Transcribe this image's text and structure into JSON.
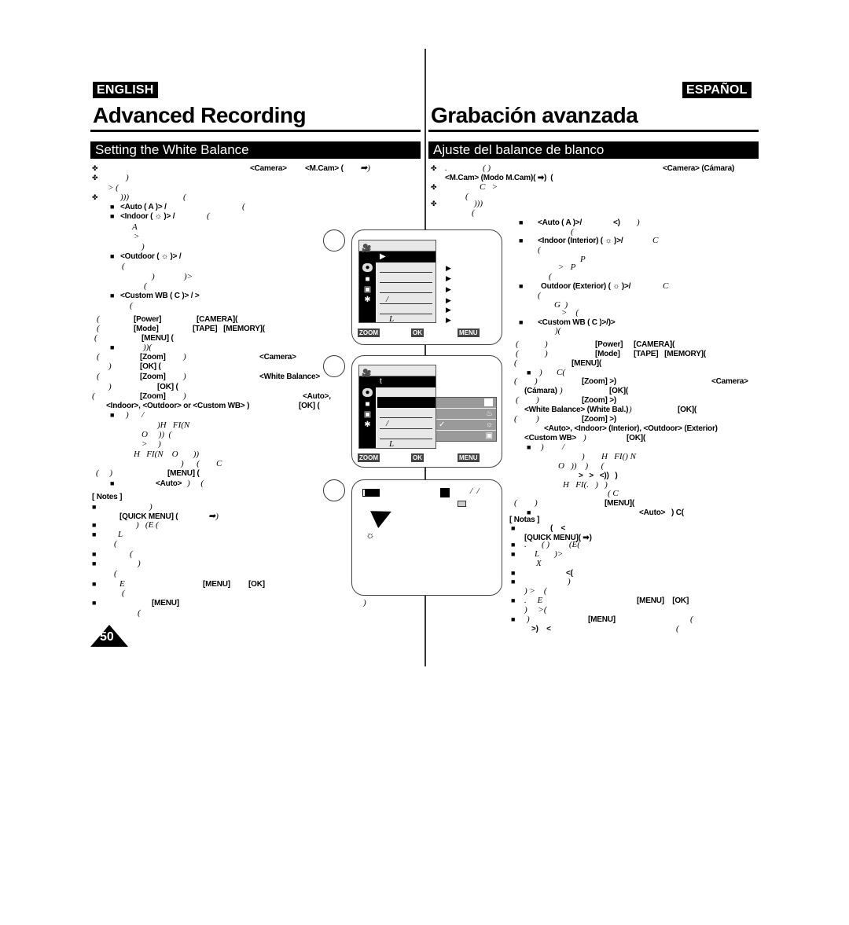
{
  "header": {
    "lang_en": "ENGLISH",
    "lang_es": "ESPAÑOL",
    "title_en": "Advanced Recording",
    "title_es": "Grabación avanzada",
    "section_en": "Setting the White Balance",
    "section_es": "Ajuste del balance de blanco"
  },
  "english": {
    "lines": [
      [
        "✤",
        "<Camera>",
        "<M.Cam> (",
        "➡)"
      ],
      [
        "✤",
        ")"
      ],
      [
        "> ("
      ],
      [
        "✤",
        ")))",
        "("
      ],
      [
        "■",
        "<Auto ( A )> /",
        "("
      ],
      [
        "■",
        "<Indoor ( ☼ )> /",
        "("
      ],
      [
        "A"
      ],
      [
        ">"
      ],
      [
        ")"
      ],
      [
        "■",
        "<Outdoor ( ☼ )> /"
      ],
      [
        "("
      ],
      [
        ")",
        ")>"
      ],
      [
        "("
      ],
      [
        "■",
        "<Custom WB ( C )> / >"
      ],
      [
        "("
      ],
      [
        "(",
        "[Power]",
        "[CAMERA]("
      ],
      [
        "(",
        "[Mode]",
        "[TAPE]   [MEMORY]("
      ],
      [
        "(",
        "[MENU] ("
      ],
      [
        "■",
        "))("
      ],
      [
        "(",
        "[Zoom]",
        ")",
        "<Camera>"
      ],
      [
        ")",
        "[OK] ("
      ],
      [
        "(",
        "[Zoom]",
        ")",
        "<White Balance>"
      ],
      [
        ")",
        "[OK] ("
      ],
      [
        "(",
        "[Zoom]",
        ")",
        "<Auto>,"
      ],
      [
        "<Indoor>, <Outdoor> or <Custom WB> )",
        "[OK] ("
      ],
      [
        "■",
        ")      /"
      ],
      [
        ")H   FI(N"
      ],
      [
        "O     ))  ("
      ],
      [
        ">     )"
      ],
      [
        "H   FI(N    O       ))"
      ],
      [
        ")      (",
        "C"
      ],
      [
        "(     )",
        "[MENU] ("
      ],
      [
        "■",
        "<Auto>",
        ")     ("
      ],
      [
        "[ Notes ]"
      ],
      [
        "■",
        ")"
      ],
      [
        "[QUICK MENU] (",
        "➡)"
      ],
      [
        "■",
        ")   (E ("
      ],
      [
        "■",
        "L"
      ],
      [
        "("
      ],
      [
        "■",
        "("
      ],
      [
        "■",
        ")"
      ],
      [
        "("
      ],
      [
        "■",
        "E",
        "[MENU]",
        "[OK]"
      ],
      [
        "("
      ],
      [
        "■",
        "[MENU]",
        ")"
      ],
      [
        "("
      ]
    ]
  },
  "spanish": {
    "lines": [
      [
        "✤",
        ".",
        "( )",
        "<Camera> (Cámara)"
      ],
      [
        "<M.Cam> (Modo M.Cam)( ➡)  ("
      ],
      [
        "✤",
        "C   >"
      ],
      [
        "("
      ],
      [
        "✤",
        ")))"
      ],
      [
        "("
      ],
      [
        "■",
        "<Auto ( A )>/",
        "<)",
        ")"
      ],
      [
        "("
      ],
      [
        "■",
        "<Indoor (Interior) ( ☼ )>/",
        "C"
      ],
      [
        "("
      ],
      [
        "P"
      ],
      [
        ">   P"
      ],
      [
        "("
      ],
      [
        "■",
        "Outdoor (Exterior) ( ☼ )>/",
        "C"
      ],
      [
        "("
      ],
      [
        "G  )"
      ],
      [
        ">    ("
      ],
      [
        "■",
        "<Custom WB ( C )>/)>"
      ],
      [
        ")("
      ],
      [
        "(",
        ")",
        "[Power]",
        "[CAMERA]("
      ],
      [
        "(",
        ")",
        "[Mode]",
        "[TAPE]   [MEMORY]("
      ],
      [
        "(",
        "[MENU]("
      ],
      [
        "■",
        ")",
        "C("
      ],
      [
        "(",
        ")",
        "[Zoom] >)",
        "<Camera>"
      ],
      [
        "(Cámara)",
        ")",
        "[OK]("
      ],
      [
        "(",
        ")",
        "[Zoom] >)"
      ],
      [
        "<White Balance> (White Bal.)",
        ")",
        "[OK]("
      ],
      [
        "(",
        ")",
        "[Zoom] >)"
      ],
      [
        "<Auto>, <Indoor> (Interior), <Outdoor> (Exterior)"
      ],
      [
        "<Custom WB>",
        ")",
        "[OK]("
      ],
      [
        "■",
        ")",
        "/"
      ],
      [
        ")",
        "H   FI() N"
      ],
      [
        "O   ))    )      ("
      ],
      [
        ">   >   <))   )"
      ],
      [
        "H   FI(.   )   )"
      ],
      [
        "( C"
      ],
      [
        "(",
        ")",
        "[MENU]("
      ],
      [
        "■",
        "<Auto>   ) C("
      ],
      [
        "[ Notas ]"
      ],
      [
        "■",
        "(    <"
      ],
      [
        "[QUICK MENU]( ➡)"
      ],
      [
        "■",
        ".       ( )         (E("
      ],
      [
        "■",
        "L       )>"
      ],
      [
        "X"
      ],
      [
        "■",
        "<("
      ],
      [
        "■",
        ")"
      ],
      [
        ") >    ("
      ],
      [
        "■",
        ".     E",
        "[MENU]    [OK]"
      ],
      [
        ")     >("
      ],
      [
        "■",
        ")",
        "[MENU]",
        "("
      ],
      [
        ">)    <",
        "("
      ]
    ]
  },
  "screens": {
    "buttons": {
      "zoom": "ZOOM",
      "ok": "OK",
      "menu": "MENU"
    },
    "menu1_arrow": "▶",
    "menu1_rows": [
      "/",
      "L"
    ],
    "menu2_selected": "t",
    "menu2_rows": [
      "/",
      "L"
    ],
    "submenu": {
      "auto": "A",
      "check": "✓"
    },
    "screen3_slashes": "/  /"
  },
  "page_number": "50"
}
